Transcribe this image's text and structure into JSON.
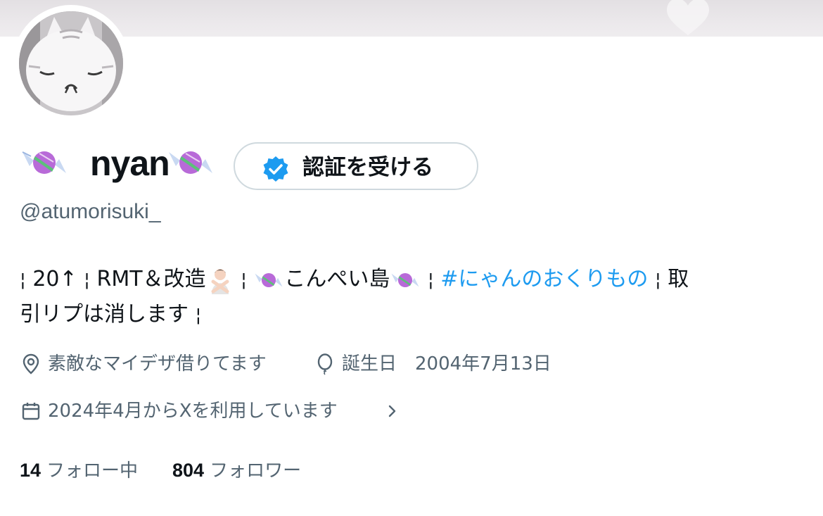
{
  "profile": {
    "display_name": "nyan",
    "display_name_emoji": "candy-icon",
    "handle": "@atumorisuki_",
    "verify_button_label": "認証を受ける"
  },
  "bio": {
    "line1": {
      "sep1": "¦",
      "age": "20↑",
      "sep2": "¦",
      "rmt": "RMT＆改造",
      "sep3": "¦",
      "island": "こんぺい島",
      "sep4": "¦",
      "hashtag": "#にゃんのおくりもの",
      "sep5": "¦",
      "tail": "取"
    },
    "line2": {
      "text": "引リプは消します",
      "sep": "¦"
    }
  },
  "meta": {
    "location": "素敵なマイデザ借りてます",
    "birthday": "誕生日　2004年7月13日",
    "joined": "2024年4月からXを利用しています"
  },
  "stats": {
    "following_count": "14",
    "following_label": "フォロー中",
    "followers_count": "804",
    "followers_label": "フォロワー"
  },
  "colors": {
    "accent": "#1d9bf0",
    "secondary_text": "#536471",
    "primary_text": "#0f1419",
    "border": "#cfd9de"
  }
}
